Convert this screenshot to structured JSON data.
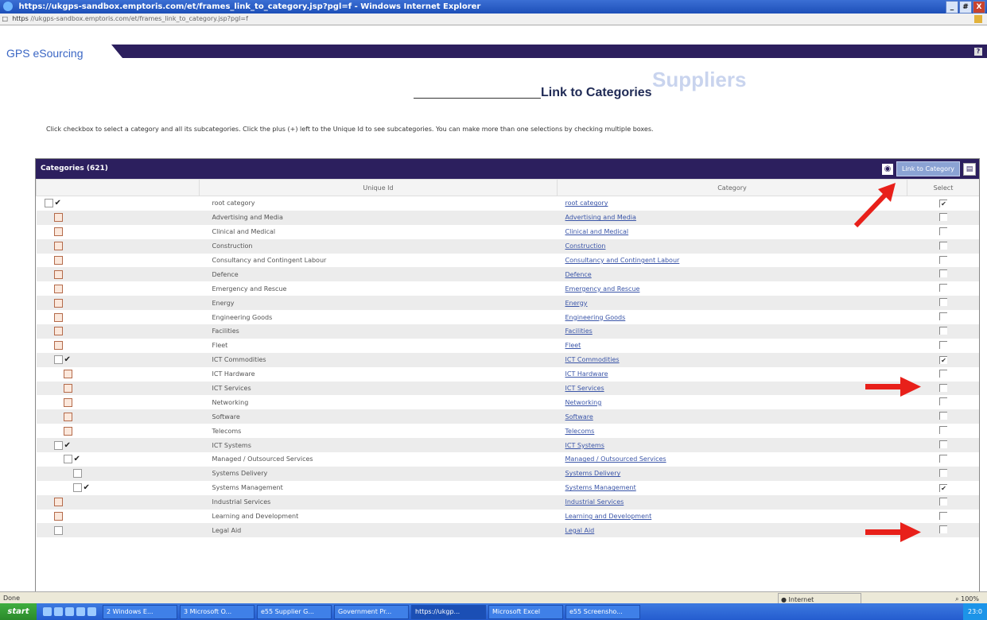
{
  "window": {
    "title": "https://ukgps-sandbox.emptoris.com/et/frames_link_to_category.jsp?pgl=f - Windows Internet Explorer",
    "address_prefix": "https",
    "address_url": "//ukgps-sandbox.emptoris.com/et/frames_link_to_category.jsp?pgl=f",
    "controls": [
      "_",
      "#",
      "X"
    ]
  },
  "app": {
    "brand": "GPS eSourcing",
    "help_label": "?"
  },
  "page": {
    "section_watermark": "Suppliers",
    "title": "Link to Categories",
    "instructions": "Click checkbox to select a category and all its subcategories. Click the plus (+) left to the Unique Id to see subcategories. You can make more than one selections by checking multiple boxes."
  },
  "panel": {
    "title": "Categories (621)",
    "link_button": "Link to Category",
    "columns": [
      "",
      "Unique Id",
      "Category",
      "Select"
    ],
    "rows": [
      {
        "indent": 0,
        "icon": "box",
        "marked": true,
        "uid": "root category",
        "category": "root category",
        "selected": true
      },
      {
        "indent": 1,
        "icon": "plus",
        "marked": false,
        "uid": "Advertising and Media",
        "category": "Advertising and Media",
        "selected": false
      },
      {
        "indent": 1,
        "icon": "plus",
        "marked": false,
        "uid": "Clinical and Medical",
        "category": "Clinical and Medical",
        "selected": false
      },
      {
        "indent": 1,
        "icon": "plus",
        "marked": false,
        "uid": "Construction",
        "category": "Construction",
        "selected": false
      },
      {
        "indent": 1,
        "icon": "plus",
        "marked": false,
        "uid": "Consultancy and Contingent Labour",
        "category": "Consultancy and Contingent Labour",
        "selected": false
      },
      {
        "indent": 1,
        "icon": "plus",
        "marked": false,
        "uid": "Defence",
        "category": "Defence",
        "selected": false
      },
      {
        "indent": 1,
        "icon": "plus",
        "marked": false,
        "uid": "Emergency and Rescue",
        "category": "Emergency and Rescue",
        "selected": false
      },
      {
        "indent": 1,
        "icon": "plus",
        "marked": false,
        "uid": "Energy",
        "category": "Energy",
        "selected": false
      },
      {
        "indent": 1,
        "icon": "plus",
        "marked": false,
        "uid": "Engineering Goods",
        "category": "Engineering Goods",
        "selected": false
      },
      {
        "indent": 1,
        "icon": "plus",
        "marked": false,
        "uid": "Facilities",
        "category": "Facilities",
        "selected": false
      },
      {
        "indent": 1,
        "icon": "plus",
        "marked": false,
        "uid": "Fleet",
        "category": "Fleet",
        "selected": false
      },
      {
        "indent": 1,
        "icon": "box",
        "marked": true,
        "uid": "ICT Commodities",
        "category": "ICT Commodities",
        "selected": true
      },
      {
        "indent": 2,
        "icon": "plus",
        "marked": false,
        "uid": "ICT Hardware",
        "category": "ICT Hardware",
        "selected": false
      },
      {
        "indent": 2,
        "icon": "plus",
        "marked": false,
        "uid": "ICT Services",
        "category": "ICT Services",
        "selected": false
      },
      {
        "indent": 2,
        "icon": "plus",
        "marked": false,
        "uid": "Networking",
        "category": "Networking",
        "selected": false
      },
      {
        "indent": 2,
        "icon": "plus",
        "marked": false,
        "uid": "Software",
        "category": "Software",
        "selected": false
      },
      {
        "indent": 2,
        "icon": "plus",
        "marked": false,
        "uid": "Telecoms",
        "category": "Telecoms",
        "selected": false
      },
      {
        "indent": 1,
        "icon": "box",
        "marked": true,
        "uid": "ICT Systems",
        "category": "ICT Systems",
        "selected": false
      },
      {
        "indent": 2,
        "icon": "box",
        "marked": true,
        "uid": "Managed / Outsourced Services",
        "category": "Managed / Outsourced Services",
        "selected": false
      },
      {
        "indent": 3,
        "icon": "box",
        "marked": false,
        "uid": "Systems Delivery",
        "category": "Systems Delivery",
        "selected": false
      },
      {
        "indent": 3,
        "icon": "box",
        "marked": true,
        "uid": "Systems Management",
        "category": "Systems Management",
        "selected": true
      },
      {
        "indent": 1,
        "icon": "plus",
        "marked": false,
        "uid": "Industrial Services",
        "category": "Industrial Services",
        "selected": false
      },
      {
        "indent": 1,
        "icon": "plus",
        "marked": false,
        "uid": "Learning and Development",
        "category": "Learning and Development",
        "selected": false
      },
      {
        "indent": 1,
        "icon": "box",
        "marked": false,
        "uid": "Legal Aid",
        "category": "Legal Aid",
        "selected": false
      }
    ]
  },
  "statusbar": {
    "status": "Done",
    "zone": "Internet",
    "zoom": "100%"
  },
  "taskbar": {
    "start": "start",
    "tasks": [
      "2 Windows E...",
      "3 Microsoft O...",
      "e55 Supplier G...",
      "Government Pr...",
      "https://ukgp...",
      "Microsoft Excel",
      "e55 Screensho..."
    ],
    "active_index": 4,
    "clock": "23:0"
  },
  "colors": {
    "header_purple": "#2c1f5e",
    "link_blue": "#3a55a8",
    "arrow_red": "#e8201a"
  }
}
